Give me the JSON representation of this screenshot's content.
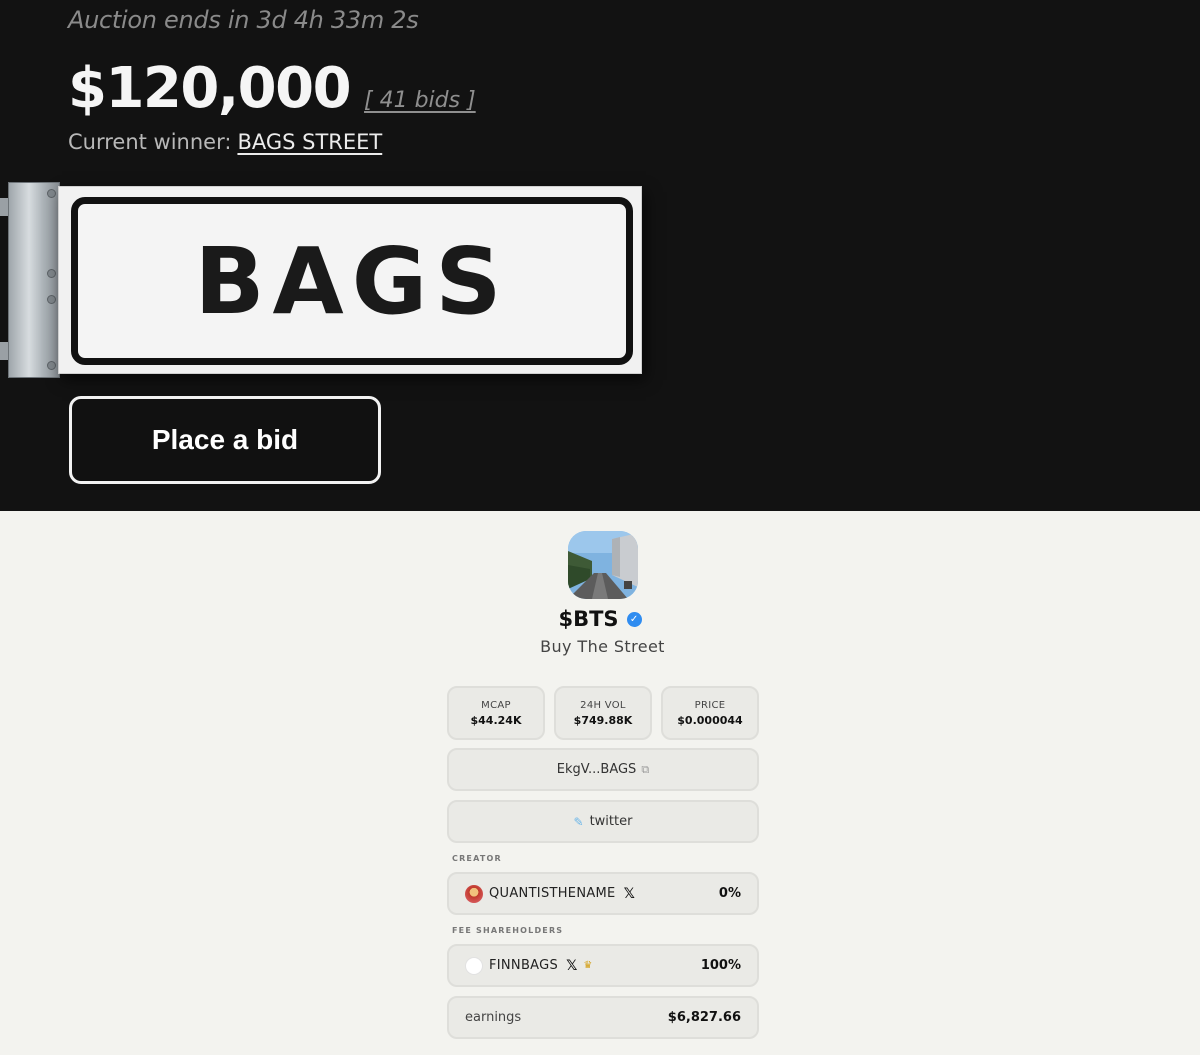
{
  "auction": {
    "countdown": "Auction ends in 3d 4h 33m 2s",
    "price": "$120,000",
    "bids": "[ 41 bids ]",
    "winner_label": "Current winner:",
    "winner_name": "BAGS STREET",
    "sign_text": "BAGS",
    "bid_button": "Place a bid"
  },
  "token": {
    "avatar_icon": "street-photo",
    "ticker": "$BTS",
    "name": "Buy The Street",
    "stats": [
      {
        "label": "MCAP",
        "value": "$44.24K"
      },
      {
        "label": "24H VOL",
        "value": "$749.88K"
      },
      {
        "label": "PRICE",
        "value": "$0.000044"
      }
    ],
    "contract": "EkgV...BAGS",
    "twitter": "twitter",
    "creator_label": "CREATOR",
    "creator": {
      "name": "QUANTISTHENAME",
      "pct": "0%"
    },
    "shareholders_label": "FEE SHAREHOLDERS",
    "shareholder": {
      "name": "FINNBAGS",
      "pct": "100%"
    },
    "earnings_label": "earnings",
    "earnings_value": "$6,827.66"
  },
  "colors": {
    "dark_bg": "#121212",
    "light_bg": "#f3f3ef",
    "verified": "#2f8cf0"
  }
}
